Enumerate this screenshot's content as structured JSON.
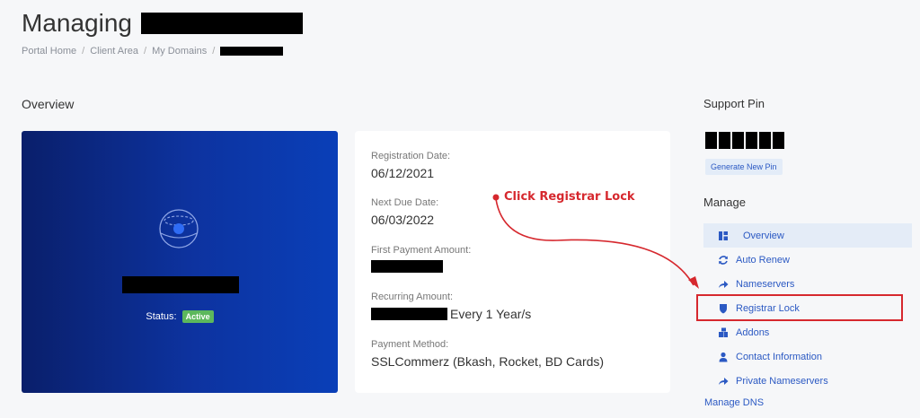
{
  "header": {
    "title": "Managing"
  },
  "breadcrumb": {
    "items": [
      "Portal Home",
      "Client Area",
      "My Domains"
    ],
    "separator": "/"
  },
  "overview": {
    "heading": "Overview",
    "status_label": "Status:",
    "status_value": "Active"
  },
  "details": {
    "registration_date_label": "Registration Date:",
    "registration_date": "06/12/2021",
    "next_due_label": "Next Due Date:",
    "next_due": "06/03/2022",
    "first_payment_label": "First Payment Amount:",
    "recurring_label": "Recurring Amount:",
    "recurring_suffix": "Every 1 Year/s",
    "payment_method_label": "Payment Method:",
    "payment_method": "SSLCommerz (Bkash, Rocket, BD Cards)"
  },
  "support": {
    "heading": "Support Pin",
    "generate_label": "Generate New Pin"
  },
  "manage": {
    "heading": "Manage",
    "items": [
      {
        "label": "Overview",
        "icon": "dashboard-icon"
      },
      {
        "label": "Auto Renew",
        "icon": "refresh-icon"
      },
      {
        "label": "Nameservers",
        "icon": "share-arrow-icon"
      },
      {
        "label": "Registrar Lock",
        "icon": "shield-icon"
      },
      {
        "label": "Addons",
        "icon": "cubes-icon"
      },
      {
        "label": "Contact Information",
        "icon": "user-icon"
      },
      {
        "label": "Private Nameservers",
        "icon": "share-arrow-icon"
      }
    ],
    "dns_label": "Manage DNS"
  },
  "annotation": {
    "text": "Click Registrar Lock",
    "color": "#d6282e"
  },
  "colors": {
    "accent": "#2b59c3",
    "card_gradient_start": "#0a1f6b",
    "card_gradient_end": "#0a3fb8",
    "status_green": "#5cb85c"
  }
}
